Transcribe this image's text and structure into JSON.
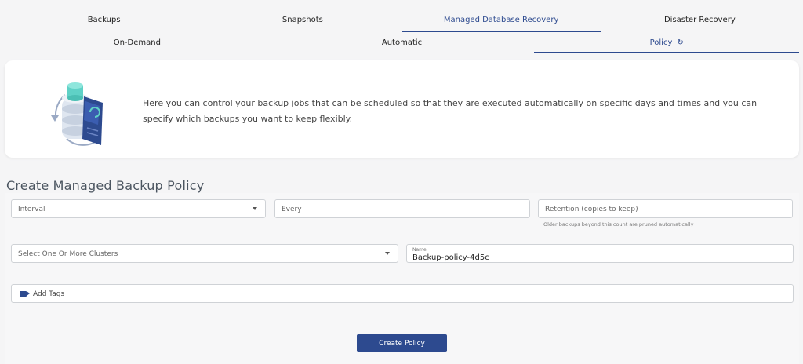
{
  "tabs_primary": [
    "Backups",
    "Snapshots",
    "Managed Database Recovery",
    "Disaster Recovery"
  ],
  "tabs_secondary": [
    "On-Demand",
    "Automatic",
    "Policy"
  ],
  "info": {
    "text": "Here you can control your backup jobs that can be scheduled so that they are executed automatically on specific days and times and you can specify which backups you want to keep flexibly."
  },
  "form": {
    "title": "Create Managed Backup Policy",
    "interval_placeholder": "Interval",
    "every_placeholder": "Every",
    "retention_placeholder": "Retention (copies to keep)",
    "retention_hint": "Older backups beyond this count are pruned automatically",
    "clusters_placeholder": "Select One Or More Clusters",
    "name_label": "Name",
    "name_value": "Backup-policy-4d5c",
    "tags_placeholder": "Add Tags",
    "submit_label": "Create Policy"
  },
  "colors": {
    "accent": "#2d4a8f",
    "background": "#f5f5f6"
  },
  "icons": {
    "refresh": "refresh-icon",
    "tag": "tag-icon",
    "dropdown": "chevron-down-icon"
  }
}
